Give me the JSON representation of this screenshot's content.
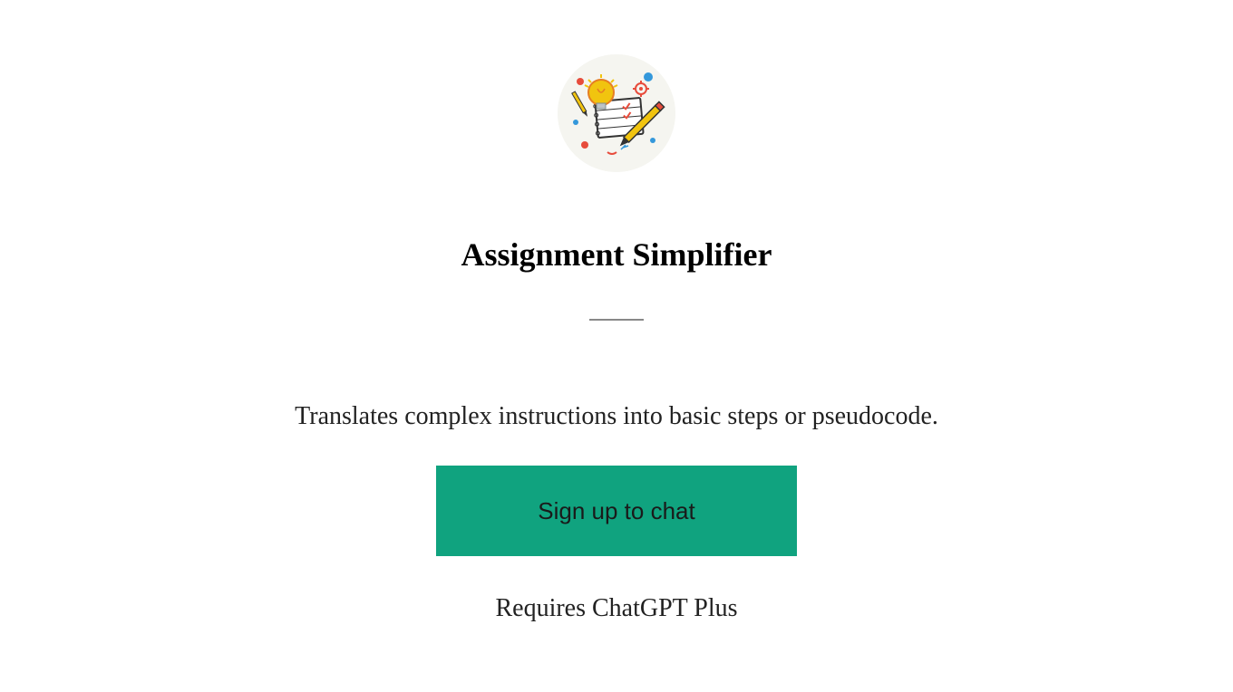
{
  "header": {
    "title": "Assignment Simplifier",
    "logo_alt": "notebook-lightbulb-pencil-icon"
  },
  "main": {
    "description": "Translates complex instructions into basic steps or pseudocode.",
    "button_label": "Sign up to chat",
    "requirement_text": "Requires ChatGPT Plus"
  },
  "colors": {
    "primary": "#10a37f",
    "text": "#222222",
    "background": "#ffffff"
  }
}
